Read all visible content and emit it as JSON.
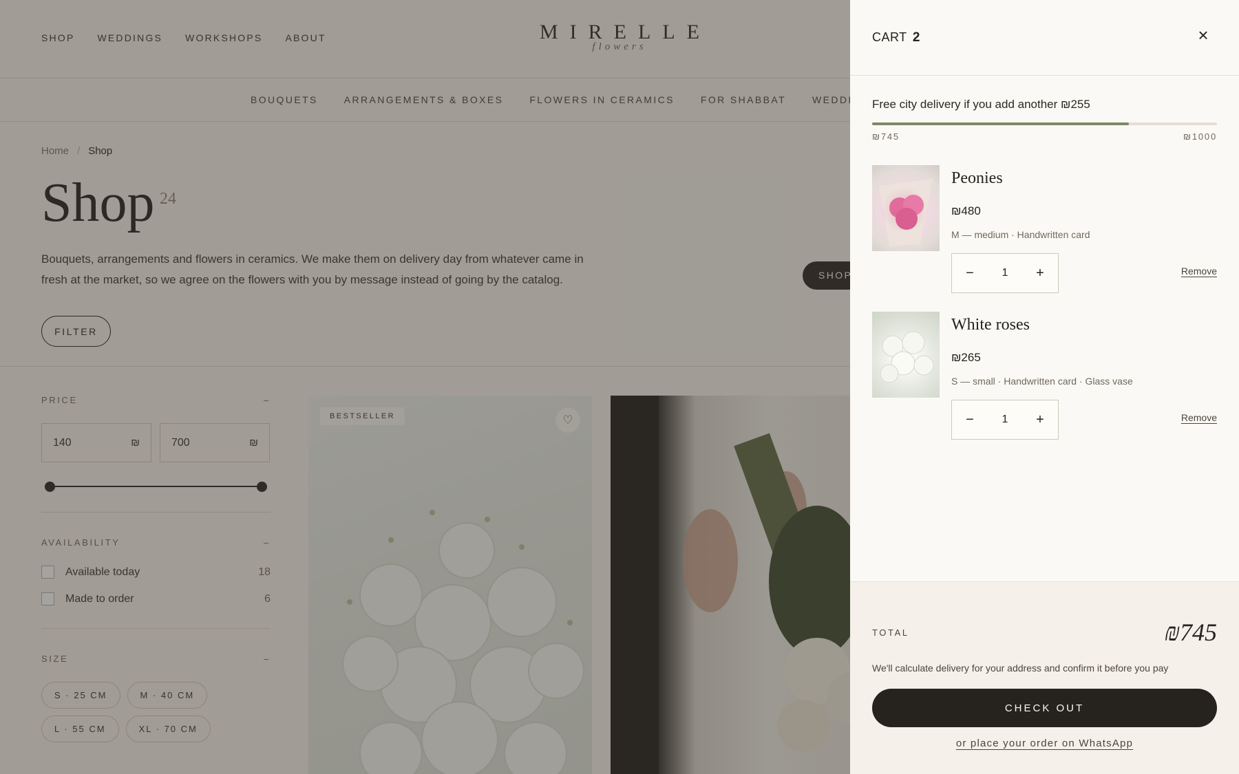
{
  "header": {
    "nav": [
      "SHOP",
      "WEDDINGS",
      "WORKSHOPS",
      "ABOUT"
    ],
    "logo": {
      "main": "MIRELLE",
      "sub": "flowers"
    }
  },
  "category_nav": [
    "BOUQUETS",
    "ARRANGEMENTS & BOXES",
    "FLOWERS IN CERAMICS",
    "FOR SHABBAT",
    "WEDDINGS & E"
  ],
  "breadcrumb": {
    "home": "Home",
    "separator": "/",
    "current": "Shop"
  },
  "page": {
    "title": "Shop",
    "count": "24",
    "description": "Bouquets, arrangements and flowers in ceramics. We make them on delivery day from whatever came in fresh at the market, so we agree on the flowers with you by message instead of going by the catalog.",
    "filter_label": "FILTER",
    "shop_pill": "SHOP"
  },
  "filters": {
    "price": {
      "label": "PRICE",
      "toggle": "–",
      "min": "140",
      "max": "700",
      "currency": "₪"
    },
    "availability": {
      "label": "AVAILABILITY",
      "toggle": "–",
      "options": [
        {
          "label": "Available today",
          "count": "18"
        },
        {
          "label": "Made to order",
          "count": "6"
        }
      ]
    },
    "size": {
      "label": "SIZE",
      "toggle": "–",
      "options": [
        "S · 25 CM",
        "M · 40 CM",
        "L · 55 CM",
        "XL · 70 CM"
      ]
    }
  },
  "products": [
    {
      "badge": "BESTSELLER",
      "heart_icon": "♡"
    }
  ],
  "cart": {
    "title": "CART",
    "count": "2",
    "close_icon": "×",
    "delivery_message": "Free city delivery if you add another ₪255",
    "progress": {
      "fraction": 0.745,
      "min_label": "₪745",
      "max_label": "₪1000"
    },
    "items": [
      {
        "name": "Peonies",
        "price": "₪480",
        "options": "M — medium · Handwritten card",
        "qty": "1",
        "minus": "−",
        "plus": "+",
        "remove": "Remove"
      },
      {
        "name": "White roses",
        "price": "₪265",
        "options": "S — small · Handwritten card · Glass vase",
        "qty": "1",
        "minus": "−",
        "plus": "+",
        "remove": "Remove"
      }
    ],
    "total_label": "TOTAL",
    "total_value": "₪745",
    "note": "We'll calculate delivery for your address and confirm it before you pay",
    "checkout": "CHECK OUT",
    "whatsapp": "or place your order on WhatsApp"
  },
  "colors": {
    "accent": "#26221e",
    "progress": "#7b8a66",
    "drawer_bg": "#fbf9f5"
  }
}
